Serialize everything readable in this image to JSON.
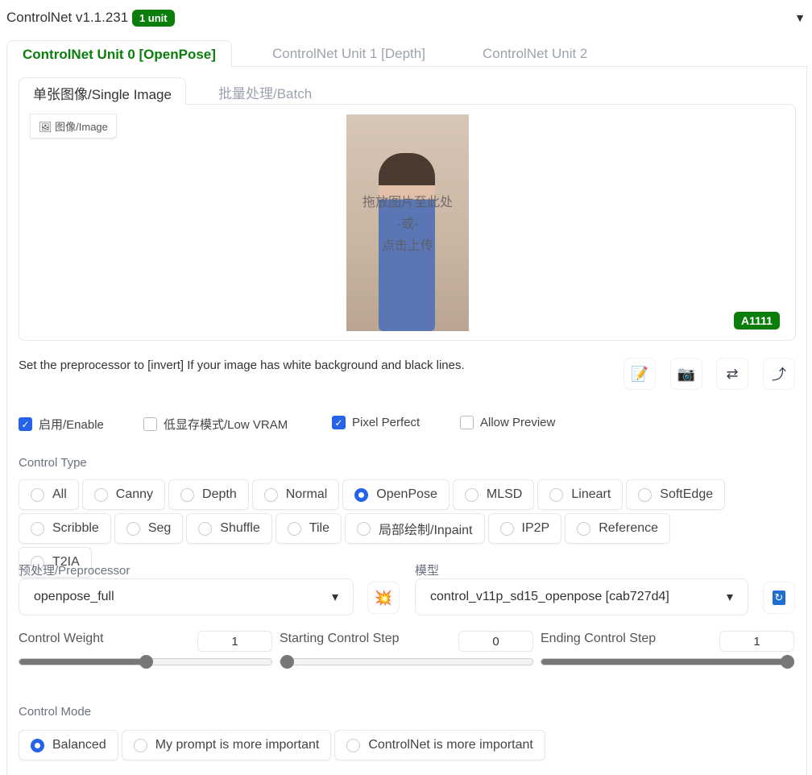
{
  "header": {
    "title": "ControlNet v1.1.231",
    "badge": "1 unit",
    "collapse_icon": "triangle-down"
  },
  "unit_tabs": [
    {
      "label": "ControlNet Unit 0 [OpenPose]",
      "active": true
    },
    {
      "label": "ControlNet Unit 1 [Depth]"
    },
    {
      "label": "ControlNet Unit 2"
    }
  ],
  "image_tabs": [
    {
      "label": "单张图像/Single Image",
      "active": true
    },
    {
      "label": "批量处理/Batch"
    }
  ],
  "image": {
    "label": "图像/Image",
    "drop_line1": "拖放图片至此处",
    "drop_line2": "-或-",
    "drop_line3": "点击上传",
    "watermark": "A1111"
  },
  "hint": "Set the preprocessor to [invert] If your image has white background and black lines.",
  "tools": [
    "memo-icon",
    "camera-icon",
    "swap-icon",
    "send-icon"
  ],
  "checkboxes": [
    {
      "label": "启用/Enable",
      "checked": true
    },
    {
      "label": "低显存模式/Low VRAM",
      "checked": false
    },
    {
      "label": "Pixel Perfect",
      "checked": true
    },
    {
      "label": "Allow Preview",
      "checked": false
    }
  ],
  "control_type": {
    "label": "Control Type",
    "options": [
      "All",
      "Canny",
      "Depth",
      "Normal",
      "OpenPose",
      "MLSD",
      "Lineart",
      "SoftEdge",
      "Scribble",
      "Seg",
      "Shuffle",
      "Tile",
      "局部绘制/Inpaint",
      "IP2P",
      "Reference",
      "T2IA"
    ],
    "selected": "OpenPose"
  },
  "preprocessor": {
    "label": "预处理/Preprocessor",
    "value": "openpose_full"
  },
  "model": {
    "label": "模型",
    "value": "control_v11p_sd15_openpose [cab727d4]"
  },
  "sliders": [
    {
      "label": "Control Weight",
      "value": "1",
      "fraction": 0.5
    },
    {
      "label": "Starting Control Step",
      "value": "0",
      "fraction": 0
    },
    {
      "label": "Ending Control Step",
      "value": "1",
      "fraction": 1
    }
  ],
  "control_mode": {
    "label": "Control Mode",
    "options": [
      "Balanced",
      "My prompt is more important",
      "ControlNet is more important"
    ],
    "selected": "Balanced"
  },
  "colors": {
    "accent": "#0a7d0a",
    "check": "#2563eb"
  }
}
